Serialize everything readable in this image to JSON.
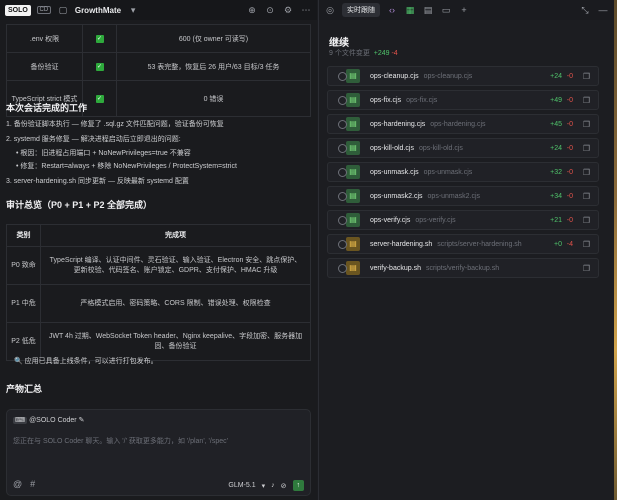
{
  "left_header": {
    "logo": "SOLO",
    "logo_badge": "CD",
    "project": "GrowthMate"
  },
  "table1": [
    {
      "name": ".env 权限",
      "status": "✓",
      "desc": "600 (仅 owner 可读写)"
    },
    {
      "name": "备份验证",
      "status": "✓",
      "desc": "53 表完整，恢复后 26 用户/63 目标/3 任务"
    },
    {
      "name": "TypeScript strict 模式",
      "status": "✓",
      "desc": "0 错误"
    }
  ],
  "section1_title": "本次会话完成的工作",
  "work": [
    {
      "n": "1.",
      "text": "备份验证脚本执行 — 修复了 .sql.gz 文件匹配问题，验证备份可恢复"
    },
    {
      "n": "2.",
      "text": "systemd 服务修复 — 解决进程启动后立即退出的问题:"
    },
    {
      "n": "•",
      "text": "根因：旧进程占用端口 + NoNewPrivileges=true 不兼容"
    },
    {
      "n": "•",
      "text": "修复：Restart=always + 移除 NoNewPrivileges / ProtectSystem=strict"
    },
    {
      "n": "3.",
      "text": "server-hardening.sh 同步更新 — 反映最新 systemd 配置"
    }
  ],
  "audit_title": "审计总览（P0 + P1 + P2 全部完成）",
  "audit_headers": [
    "类别",
    "完成项"
  ],
  "audit_rows": [
    {
      "cat": "P0 致命",
      "items": "TypeScript 编译、认证中间件、灵石验证、输入验证、Electron 安全、跳点保护、更新校验、代码签名、账户锁定、GDPR、支付保护、HMAC 升级"
    },
    {
      "cat": "P1 中危",
      "items": "严格模式启用、密码策略、CORS 限制、错误处理、权限检查"
    },
    {
      "cat": "P2 低危",
      "items": "JWT 4h 过期、WebSocket Token header、Nginx keepalive、字段加密、服务器加固、备份验证"
    }
  ],
  "ready_text": "应用已具备上线条件，可以进行打包发布。",
  "product_title": "产物汇总",
  "chat": {
    "agent": "@SOLO Coder",
    "placeholder": "您正在与 SOLO Coder 聊天。输入 '/' 获取更多能力，如 '/plan', '/spec'",
    "model": "GLM-5.1"
  },
  "right_header": {
    "tab": "实时跟随"
  },
  "changes": {
    "title": "继续",
    "summary": "9 个文件变更",
    "add": "+249",
    "del": "-4"
  },
  "files": [
    {
      "name": "ops-cleanup.cjs",
      "path": "ops-cleanup.cjs",
      "add": "+24",
      "del": "-0",
      "type": "js"
    },
    {
      "name": "ops-fix.cjs",
      "path": "ops-fix.cjs",
      "add": "+49",
      "del": "-0",
      "type": "js"
    },
    {
      "name": "ops-hardening.cjs",
      "path": "ops-hardening.cjs",
      "add": "+45",
      "del": "-0",
      "type": "js"
    },
    {
      "name": "ops-kill-old.cjs",
      "path": "ops-kill-old.cjs",
      "add": "+24",
      "del": "-0",
      "type": "js"
    },
    {
      "name": "ops-unmask.cjs",
      "path": "ops-unmask.cjs",
      "add": "+32",
      "del": "-0",
      "type": "js"
    },
    {
      "name": "ops-unmask2.cjs",
      "path": "ops-unmask2.cjs",
      "add": "+34",
      "del": "-0",
      "type": "js"
    },
    {
      "name": "ops-verify.cjs",
      "path": "ops-verify.cjs",
      "add": "+21",
      "del": "-0",
      "type": "js"
    },
    {
      "name": "server-hardening.sh",
      "path": "scripts/server-hardening.sh",
      "add": "+0",
      "del": "-4",
      "type": "sh"
    },
    {
      "name": "verify-backup.sh",
      "path": "scripts/verify-backup.sh",
      "add": "",
      "del": "",
      "type": "sh"
    }
  ]
}
